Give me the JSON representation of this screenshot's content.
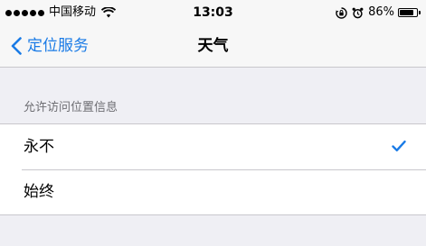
{
  "status_bar": {
    "carrier": "中国移动",
    "time": "13:03",
    "battery_percent_label": "86%",
    "battery_level": 0.86,
    "signal_dots": 5,
    "icons": [
      "wifi-icon",
      "orientation-lock-icon",
      "alarm-icon",
      "battery-icon"
    ]
  },
  "nav": {
    "back_label": "定位服务",
    "title": "天气"
  },
  "section": {
    "header": "允许访问位置信息"
  },
  "options": [
    {
      "label": "永不",
      "selected": true
    },
    {
      "label": "始终",
      "selected": false
    }
  ],
  "colors": {
    "accent": "#1a7be6",
    "background": "#efeff4",
    "bar_background": "#f7f7f7",
    "separator": "#c8c7cc",
    "section_header_text": "#6d6d72"
  }
}
